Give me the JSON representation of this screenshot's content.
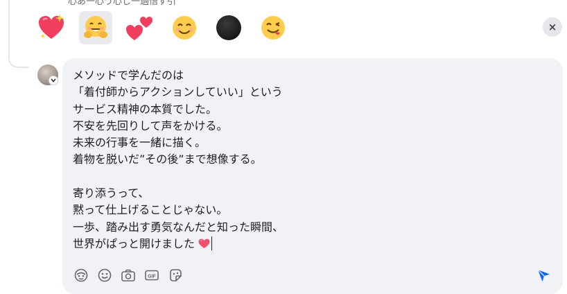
{
  "top_partial_text": "心あ一心う心し一過悟す引",
  "reactions": [
    {
      "name": "sparkling-heart-emoji",
      "selected": false
    },
    {
      "name": "hugging-face-emoji",
      "selected": true
    },
    {
      "name": "two-hearts-emoji",
      "selected": false
    },
    {
      "name": "smiling-face-emoji",
      "selected": false
    },
    {
      "name": "black-circle-emoji",
      "selected": false
    },
    {
      "name": "savoring-food-face-emoji",
      "selected": false
    }
  ],
  "close_icon": "×",
  "composer": {
    "lines": [
      "メソッドで学んだのは",
      "「着付師からアクションしていい」という",
      "サービス精神の本質でした。",
      "不安を先回りして声をかける。",
      "未来の行事を一緒に描く。",
      "着物を脱いだ”その後”まで想像する。",
      "",
      "寄り添うって、",
      "黙って仕上げることじゃない。",
      "一歩、踏み出す勇気なんだと知った瞬間、",
      "世界がぱっと開けました"
    ],
    "trailing_emoji": "heart-emoji"
  },
  "toolbar": {
    "icons": [
      "avatar-sticker-icon",
      "emoji-icon",
      "camera-icon",
      "gif-icon",
      "sticker-icon"
    ],
    "gif_label": "GIF",
    "send_icon": "send-icon"
  },
  "colors": {
    "composer_bg": "#f0f2f5",
    "send": "#0866ff",
    "heart": "#f0506e"
  }
}
